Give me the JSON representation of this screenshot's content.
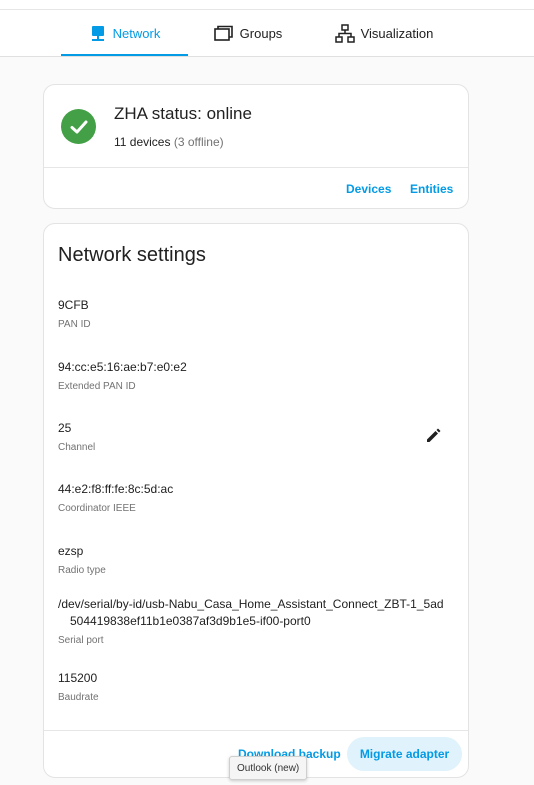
{
  "tabs": [
    {
      "label": "Network",
      "icon": "network-icon",
      "active": true
    },
    {
      "label": "Groups",
      "icon": "groups-icon",
      "active": false
    },
    {
      "label": "Visualization",
      "icon": "visualization-icon",
      "active": false
    }
  ],
  "status": {
    "title": "ZHA status: online",
    "devices": "11 devices",
    "offline": "(3 offline)",
    "devices_button": "Devices",
    "entities_button": "Entities",
    "icon": "check-circle-icon"
  },
  "settings": {
    "title": "Network settings",
    "fields": [
      {
        "value": "9CFB",
        "label": "PAN ID"
      },
      {
        "value": "94:cc:e5:16:ae:b7:e0:e2",
        "label": "Extended PAN ID"
      },
      {
        "value": "25",
        "label": "Channel"
      },
      {
        "value": "44:e2:f8:ff:fe:8c:5d:ac",
        "label": "Coordinator IEEE"
      },
      {
        "value": "ezsp",
        "label": "Radio type"
      },
      {
        "value": "/dev/serial/by-id/usb-Nabu_Casa_Home_Assistant_Connect_ZBT-1_5ad",
        "value_cont": "504419838ef11b1e0387af3d9b1e5-if00-port0",
        "label": "Serial port"
      },
      {
        "value": "115200",
        "label": "Baudrate"
      }
    ],
    "download_backup": "Download backup",
    "migrate_adapter": "Migrate adapter"
  },
  "tooltip": "Outlook (new)",
  "colors": {
    "accent": "#039be5",
    "success": "#43a047"
  }
}
